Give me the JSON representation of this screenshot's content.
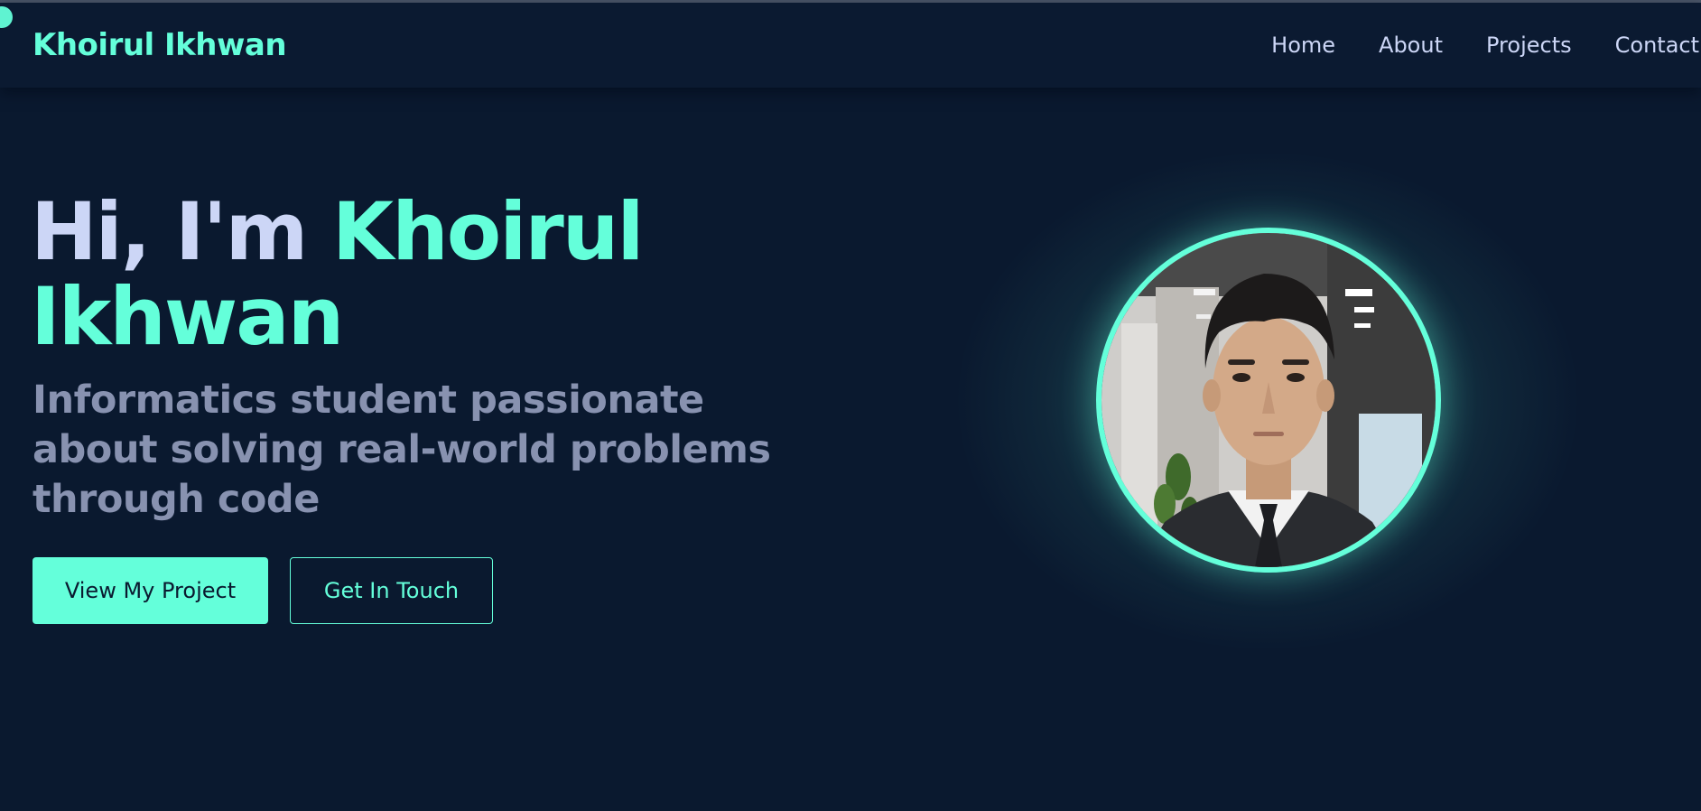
{
  "brand": "Khoirul Ikhwan",
  "nav": {
    "items": [
      "Home",
      "About",
      "Projects",
      "Contact"
    ]
  },
  "hero": {
    "greeting": "Hi, I'm",
    "name_first": "Khoirul",
    "name_last": "Ikhwan",
    "subtitle": "Informatics student passionate about solving real-world problems through code",
    "primary_button": "View My Project",
    "secondary_button": "Get In Touch"
  },
  "colors": {
    "background": "#0a192f",
    "accent": "#64ffda",
    "heading": "#ccd6f6",
    "muted": "#8892b0"
  },
  "icons": {
    "avatar": "profile-photo"
  }
}
